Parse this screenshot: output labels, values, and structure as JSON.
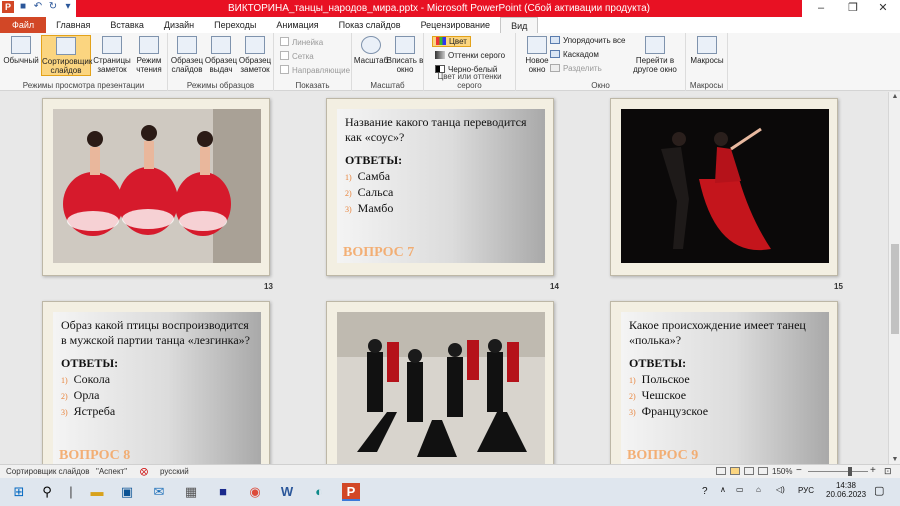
{
  "window": {
    "title": "ВИКТОРИНА_танцы_народов_мира.pptx  -  Microsoft PowerPoint (Сбой активации продукта)",
    "min": "–",
    "restore": "❐",
    "close": "✕"
  },
  "qat": {
    "app": "P",
    "save": "■",
    "undo": "↶",
    "redo": "↻",
    "more": "▾"
  },
  "tabs": [
    "Файл",
    "Главная",
    "Вставка",
    "Дизайн",
    "Переходы",
    "Анимация",
    "Показ слайдов",
    "Рецензирование",
    "Вид"
  ],
  "ribbon": {
    "view_modes": {
      "label": "Режимы просмотра презентации",
      "buttons": [
        "Обычный",
        "Сортировщик слайдов",
        "Страницы заметок",
        "Режим чтения"
      ]
    },
    "master_views": {
      "label": "Режимы образцов",
      "buttons": [
        "Образец слайдов",
        "Образец выдач",
        "Образец заметок"
      ]
    },
    "show": {
      "label": "Показать",
      "items": [
        "Линейка",
        "Сетка",
        "Направляющие"
      ]
    },
    "zoom": {
      "label": "Масштаб",
      "buttons": [
        "Масштаб",
        "Вписать в окно"
      ]
    },
    "color": {
      "label": "Цвет или оттенки серого",
      "items": [
        "Цвет",
        "Оттенки серого",
        "Черно-белый"
      ]
    },
    "window": {
      "label": "Окно",
      "new_window": "Новое окно",
      "items": [
        "Упорядочить все",
        "Каскадом",
        "Разделить"
      ],
      "switch": "Перейти в другое окно"
    },
    "macros": {
      "label": "Макросы",
      "button": "Макросы"
    }
  },
  "slides": [
    {
      "num": "13",
      "type": "photo"
    },
    {
      "num": "14",
      "type": "question",
      "question": "Название какого танца переводится как «соус»?",
      "answers_heading": "ОТВЕТЫ:",
      "answers": [
        "Самба",
        "Сальса",
        "Мамбо"
      ],
      "label": "ВОПРОС 7"
    },
    {
      "num": "15",
      "type": "photo"
    },
    {
      "type": "question",
      "question": "Образ какой птицы воспроизводится в мужской партии танца «лезгинка»?",
      "answers_heading": "ОТВЕТЫ:",
      "answers": [
        "Сокола",
        "Орла",
        "Ястреба"
      ],
      "label": "ВОПРОС 8"
    },
    {
      "type": "photo"
    },
    {
      "type": "question",
      "question": "Какое происхождение имеет танец «полька»?",
      "answers_heading": "ОТВЕТЫ:",
      "answers": [
        "Польское",
        "Чешское",
        "Французское"
      ],
      "label": "ВОПРОС 9"
    }
  ],
  "answer_numbers": [
    "1)",
    "2)",
    "3)"
  ],
  "statusbar": {
    "view": "Сортировщик слайдов",
    "theme": "\"Аспект\"",
    "language": "русский",
    "zoom": "150%"
  },
  "taskbar": {
    "time": "14:38",
    "date": "20.06.2023",
    "lang": "РУС"
  }
}
